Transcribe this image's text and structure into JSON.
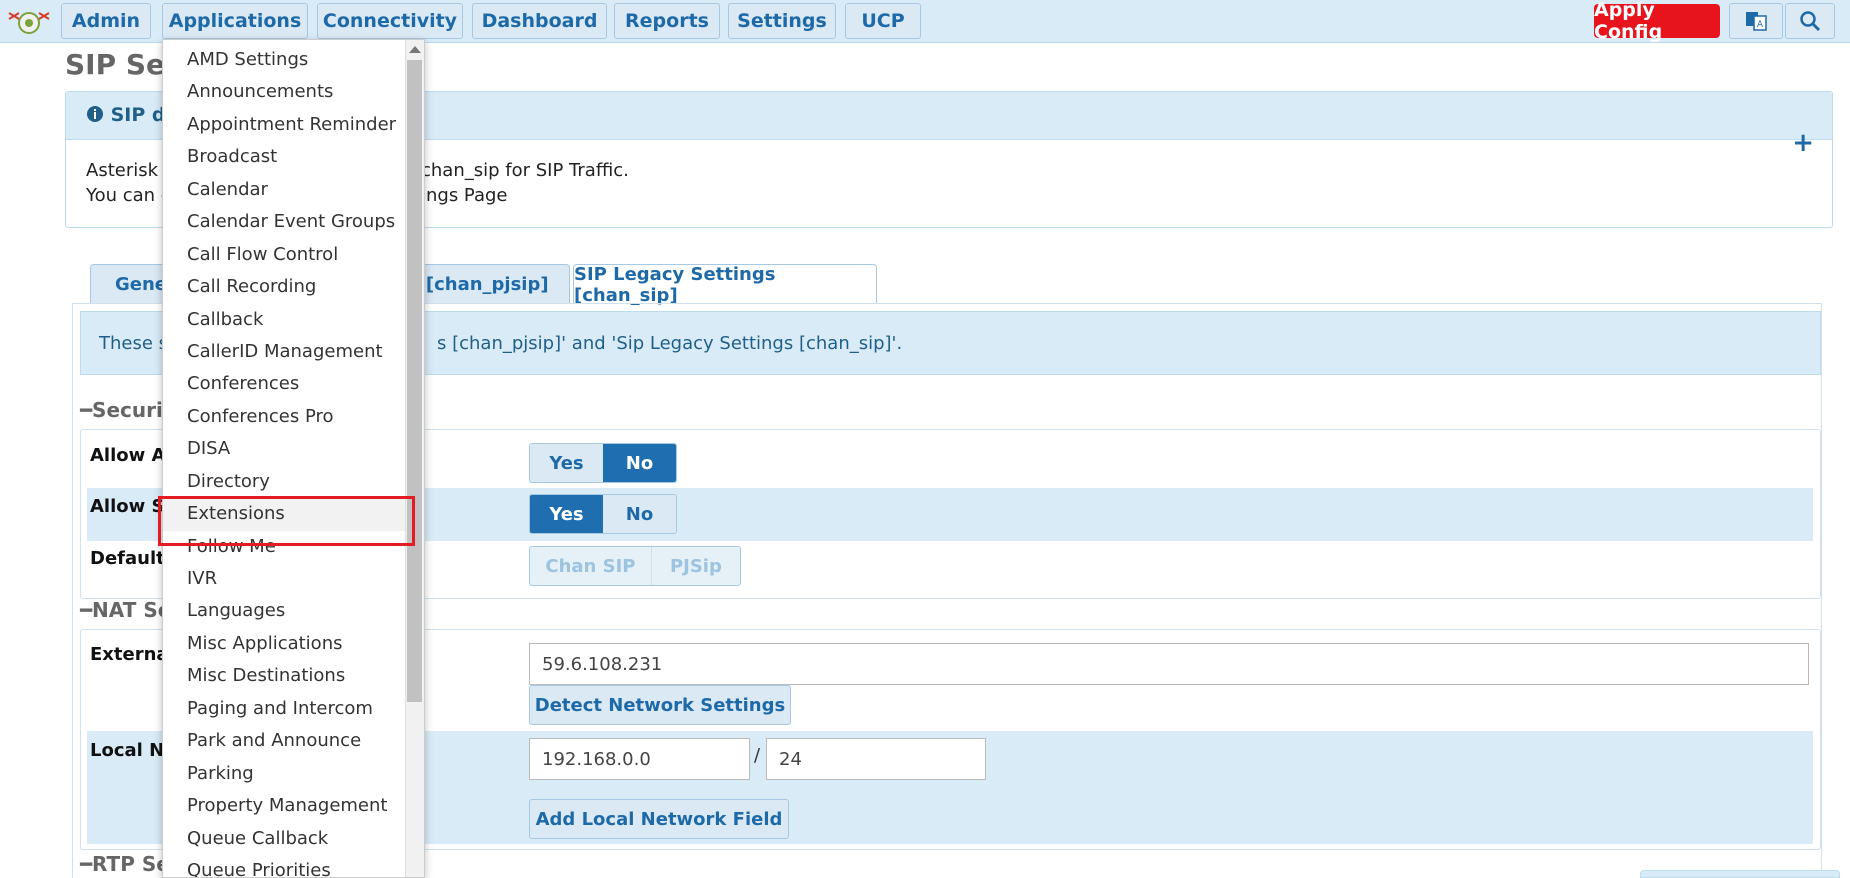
{
  "nav": {
    "items": [
      {
        "id": "admin",
        "label": "Admin"
      },
      {
        "id": "applications",
        "label": "Applications"
      },
      {
        "id": "connectivity",
        "label": "Connectivity"
      },
      {
        "id": "dashboard",
        "label": "Dashboard"
      },
      {
        "id": "reports",
        "label": "Reports"
      },
      {
        "id": "settings",
        "label": "Settings"
      },
      {
        "id": "ucp",
        "label": "UCP"
      }
    ],
    "apply_label": "Apply Config",
    "apply_color": "#e8141d"
  },
  "page": {
    "title": "SIP Sett",
    "alert_title": "SIP dr",
    "alert_line1": "Asterisk is",
    "alert_line1b": "chan_sip for SIP Traffic.",
    "alert_line2": "You can c",
    "alert_line2b": "ings Page"
  },
  "tabs": {
    "general": "Gener",
    "general_tail": "gs [chan_pjsip]",
    "legacy": "SIP Legacy Settings [chan_sip]"
  },
  "info_strip": {
    "prefix": "These s",
    "suffix": "s [chan_pjsip]' and 'Sip Legacy Settings [chan_sip]'."
  },
  "security": {
    "title": "Securit",
    "row1_label": "Allow An",
    "row2_label": "Allow SI",
    "row3_label": "Default",
    "yes": "Yes",
    "no": "No",
    "chan_sip": "Chan SIP",
    "pjsip": "PJSip"
  },
  "nat": {
    "title": "NAT Se",
    "external_label": "External",
    "external_ip": "59.6.108.231",
    "detect_button": "Detect Network Settings",
    "local_label": "Local Ne",
    "local_ip": "192.168.0.0",
    "slash": "/",
    "cidr": "24",
    "add_local_button": "Add Local Network Field"
  },
  "rtp": {
    "title": "RTP Se"
  },
  "dropdown": {
    "items": [
      "AMD Settings",
      "Announcements",
      "Appointment Reminder",
      "Broadcast",
      "Calendar",
      "Calendar Event Groups",
      "Call Flow Control",
      "Call Recording",
      "Callback",
      "CallerID Management",
      "Conferences",
      "Conferences Pro",
      "DISA",
      "Directory",
      "Extensions",
      "Follow Me",
      "IVR",
      "Languages",
      "Misc Applications",
      "Misc Destinations",
      "Paging and Intercom",
      "Park and Announce",
      "Parking",
      "Property Management",
      "Queue Callback",
      "Queue Priorities"
    ],
    "active_item": "Extensions"
  },
  "colors": {
    "accent": "#1e6aa8",
    "highlight": "#e31b23",
    "panel": "#d9ebf7"
  }
}
